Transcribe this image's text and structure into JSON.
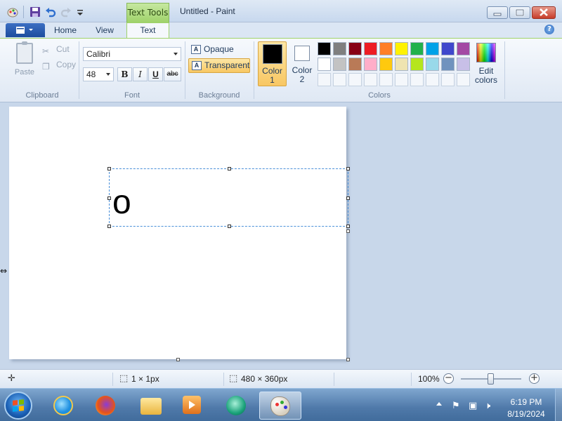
{
  "window": {
    "title": "Untitled - Paint",
    "context_tab_header": "Text Tools"
  },
  "tabs": {
    "home": "Home",
    "view": "View",
    "text": "Text"
  },
  "ribbon": {
    "clipboard": {
      "label": "Clipboard",
      "paste": "Paste",
      "cut": "Cut",
      "copy": "Copy"
    },
    "font": {
      "label": "Font",
      "family": "Calibri",
      "size": "48",
      "bold": "B",
      "italic": "I",
      "underline": "U",
      "strikethrough": "abc"
    },
    "background": {
      "label": "Background",
      "opaque": "Opaque",
      "transparent": "Transparent",
      "selected": "Transparent"
    },
    "colors": {
      "label": "Colors",
      "color1_label": "Color",
      "color1_num": "1",
      "color2_label": "Color",
      "color2_num": "2",
      "color1_value": "#000000",
      "color2_value": "#ffffff",
      "edit_line1": "Edit",
      "edit_line2": "colors",
      "palette_row1": [
        "#000000",
        "#7f7f7f",
        "#880015",
        "#ed1c24",
        "#ff7f27",
        "#fff200",
        "#22b14c",
        "#00a2e8",
        "#3f48cc",
        "#a349a4"
      ],
      "palette_row2": [
        "#ffffff",
        "#c3c3c3",
        "#b97a57",
        "#ffaec9",
        "#ffc90e",
        "#efe4b0",
        "#b5e61d",
        "#99d9ea",
        "#7092be",
        "#c8bfe7"
      ]
    }
  },
  "canvas": {
    "text_content": "o"
  },
  "statusbar": {
    "selection_size": "1 × 1px",
    "image_size": "480 × 360px",
    "zoom": "100%",
    "zoom_out": "−",
    "zoom_in": "+"
  },
  "taskbar": {
    "time": "6:19 PM",
    "date": "8/19/2024"
  }
}
